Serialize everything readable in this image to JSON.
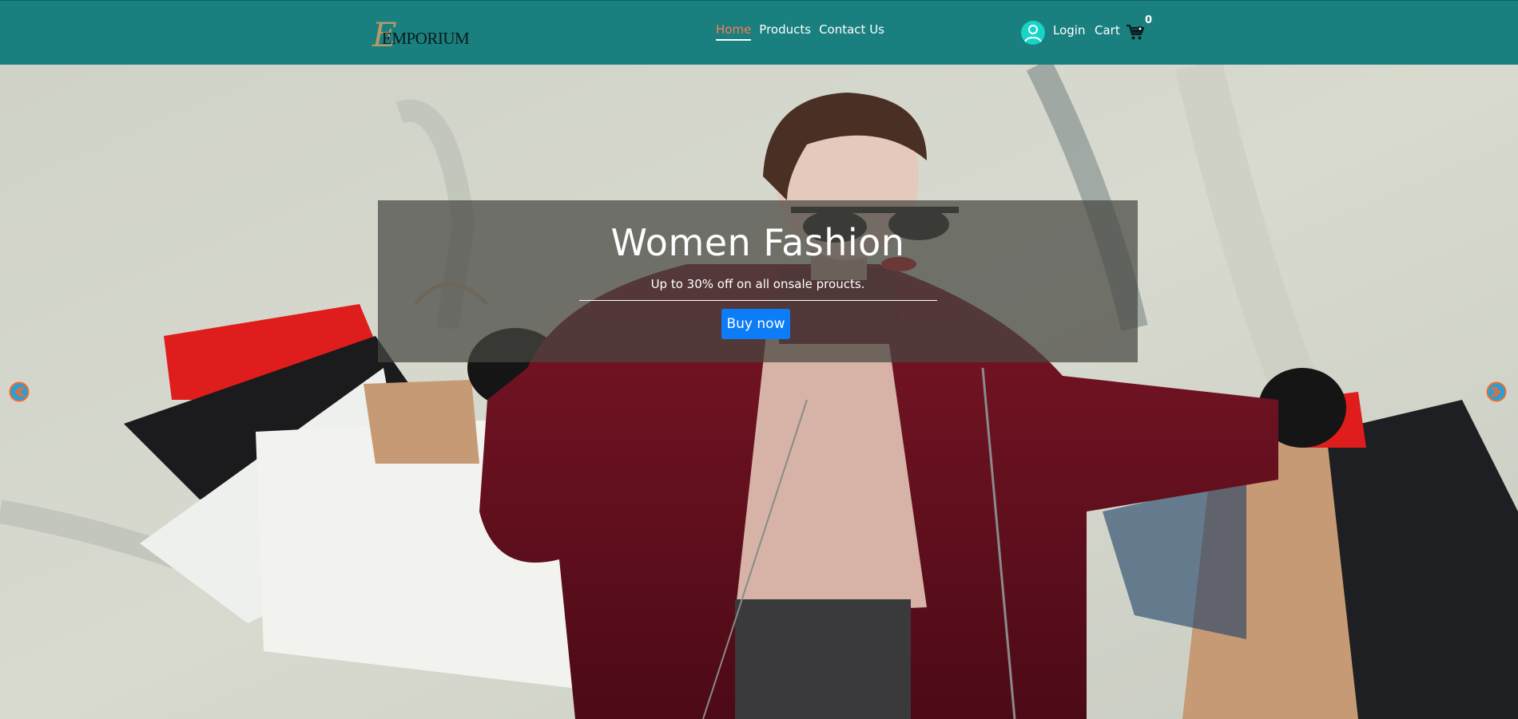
{
  "header": {
    "logo_text": "EMPORIUM",
    "logo_mark": "E",
    "nav": [
      {
        "label": "Home",
        "active": true
      },
      {
        "label": "Products",
        "active": false
      },
      {
        "label": "Contact Us",
        "active": false
      }
    ],
    "login_label": "Login",
    "cart_label": "Cart",
    "cart_count": "0",
    "icons": {
      "user": "user-avatar-icon",
      "cart": "shopping-cart-icon"
    }
  },
  "hero": {
    "title": "Women Fashion",
    "subtitle": "Up to 30% off on all onsale proucts.",
    "button_label": "Buy now",
    "prev_icon": "arrow-left-icon",
    "next_icon": "arrow-right-icon"
  },
  "colors": {
    "header_bg": "#1a7f7f",
    "nav_active": "#ff7b4f",
    "button_bg": "#0d7df7",
    "avatar_bg": "#17d3c8",
    "arrow_border": "#f26b2a",
    "arrow_fill": "#2a9fd6"
  }
}
